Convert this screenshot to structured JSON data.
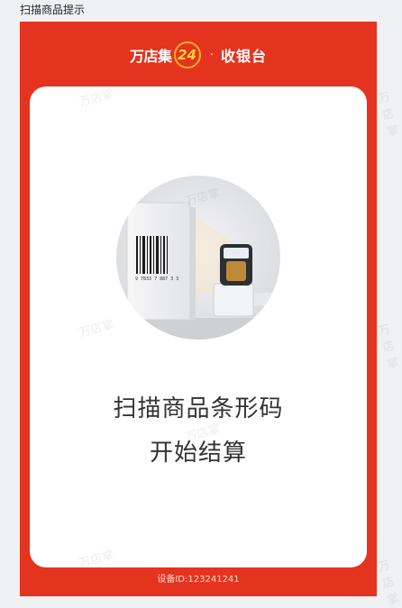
{
  "window": {
    "title": "扫描商品提示"
  },
  "header": {
    "brand": "万店集",
    "brand_number": "24",
    "separator": "·",
    "title": "收银台"
  },
  "card": {
    "line1": "扫描商品条形码",
    "line2": "开始结算"
  },
  "watermark": {
    "text": "万店掌"
  },
  "footer": {
    "device_id": "设备ID:123241241"
  },
  "colors": {
    "primary": "#e4341f",
    "card": "#ffffff",
    "accent": "#f7b11c"
  },
  "illustration": {
    "barcode_digits": "9 7833 7 887 3 3"
  }
}
